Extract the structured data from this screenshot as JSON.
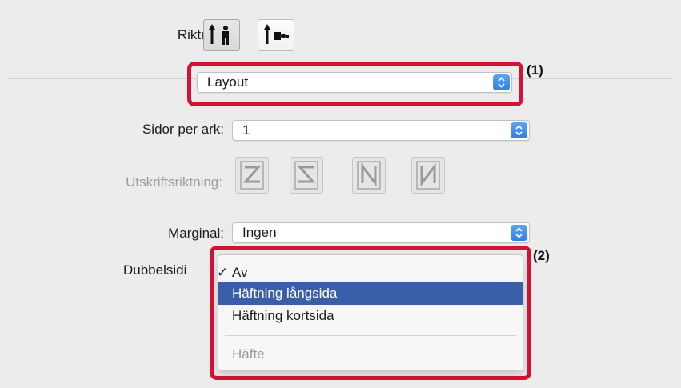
{
  "orientation": {
    "label": "Riktning:",
    "options": [
      {
        "name": "portrait",
        "selected": true
      },
      {
        "name": "landscape",
        "selected": false
      }
    ]
  },
  "panel_select": {
    "value": "Layout"
  },
  "pages_per_sheet": {
    "label": "Sidor per ark:",
    "value": "1"
  },
  "print_direction": {
    "label": "Utskriftsriktning:",
    "enabled": false,
    "options": [
      "z-order-icon",
      "reverse-z-order-icon",
      "n-order-icon",
      "reverse-n-order-icon"
    ]
  },
  "margin": {
    "label": "Marginal:",
    "value": "Ingen"
  },
  "duplex": {
    "label": "Dubbelsidi",
    "menu": {
      "items": [
        {
          "label": "Av",
          "checked": true
        },
        {
          "label": "Häftning långsida",
          "highlighted": true
        },
        {
          "label": "Häftning kortsida"
        },
        {
          "label": "Häfte",
          "disabled": true
        }
      ]
    }
  },
  "callouts": {
    "one": "(1)",
    "two": "(2)"
  },
  "colors": {
    "callout": "#d51235",
    "highlight": "#3b5ea8",
    "stepper": "#2e7fe6"
  }
}
